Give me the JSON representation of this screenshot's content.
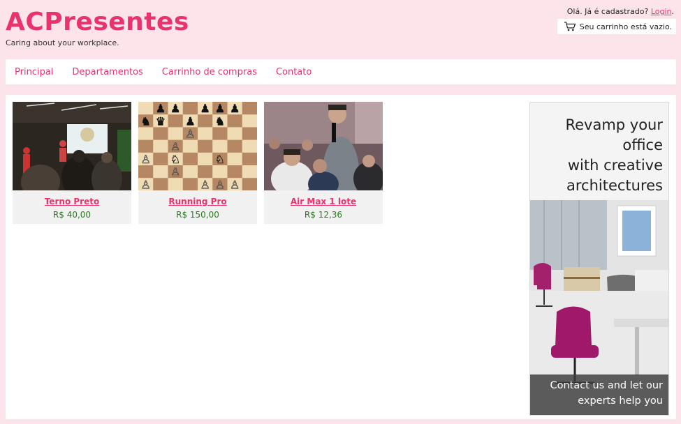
{
  "brand": {
    "logo": "ACPresentes",
    "tagline": "Caring about your workplace."
  },
  "account": {
    "prompt": "Olá. Já é cadastrado?",
    "login": "Login",
    "suffix": "."
  },
  "cart": {
    "icon": "cart-icon",
    "status": "Seu carrinho está vazio."
  },
  "nav": {
    "items": [
      "Principal",
      "Departamentos",
      "Carrinho de compras",
      "Contato"
    ]
  },
  "products": [
    {
      "name": "Terno Preto",
      "price": "R$ 40,00"
    },
    {
      "name": "Running Pro",
      "price": "R$ 150,00"
    },
    {
      "name": "Air Max 1 lote",
      "price": "R$ 12,36"
    }
  ],
  "ad": {
    "headline_lines": [
      "Revamp your",
      "office",
      "with creative",
      "architectures"
    ],
    "footer_lines": [
      "Contact us and let our",
      "experts help you"
    ]
  },
  "colors": {
    "accent": "#e8336c",
    "price": "#2a7a1f",
    "background": "#fde4ea"
  }
}
